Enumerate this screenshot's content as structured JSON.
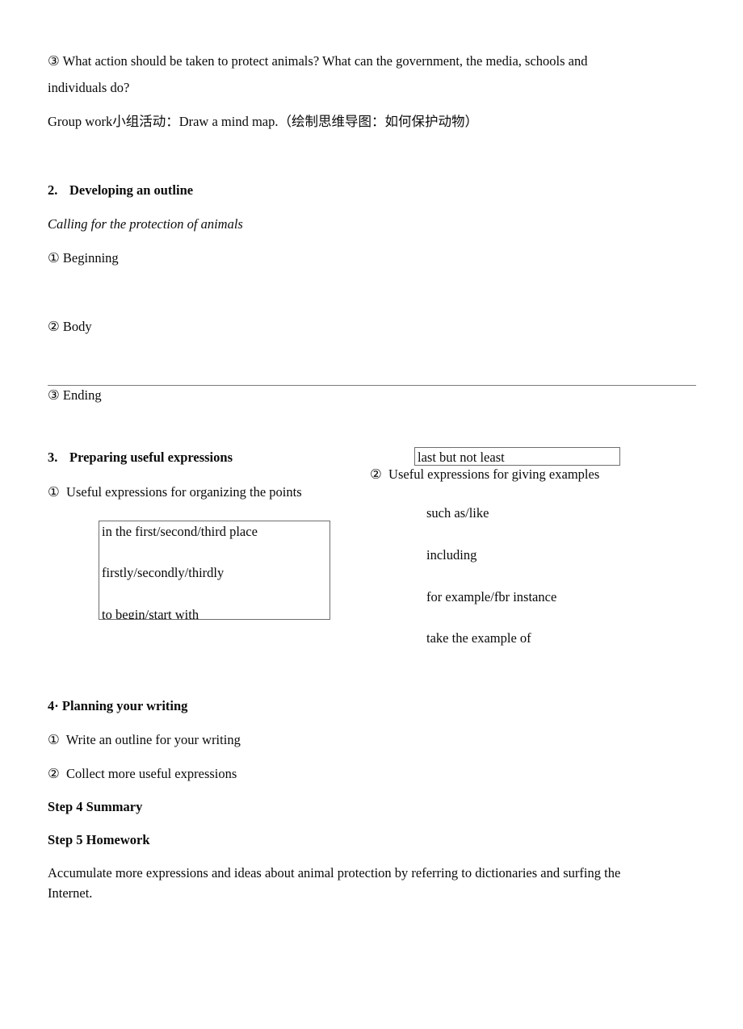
{
  "document": {
    "intro": {
      "q3_line1": "③ What action should be taken to protect animals? What can the government, the media, schools and",
      "q3_line2": "individuals do?",
      "group_work": "Group work小组活动：Draw a mind map.（绘制思维导图：如何保护动物）"
    },
    "section2": {
      "heading_number": "2.",
      "heading_title": "Developing an outline",
      "subtitle": "Calling for the protection of animals",
      "item1": "① Beginning",
      "item2": "② Body",
      "item3": "③ Ending"
    },
    "section3": {
      "heading_number": "3.",
      "heading_title": "Preparing useful expressions",
      "item1": "①  Useful expressions for organizing the points",
      "item2": "②  Useful expressions for giving examples",
      "organizing_box": {
        "line1": "in the first/second/third place",
        "line2": "firstly/secondly/thirdly",
        "line3": "to begin/start with"
      },
      "last_but_not_least_box": {
        "text": "last but not least"
      },
      "examples": [
        "such as/like",
        "including",
        "for example/fbr instance",
        "take the example of"
      ]
    },
    "section4": {
      "heading": "4· Planning your writing",
      "item1": "①  Write an outline for your writing",
      "item2": "②  Collect more useful expressions"
    },
    "step4": {
      "heading": "Step 4 Summary"
    },
    "step5": {
      "heading": "Step 5 Homework",
      "body_line1": "Accumulate more expressions and ideas about animal protection by referring to dictionaries and surfing the",
      "body_line2": "Internet."
    }
  }
}
